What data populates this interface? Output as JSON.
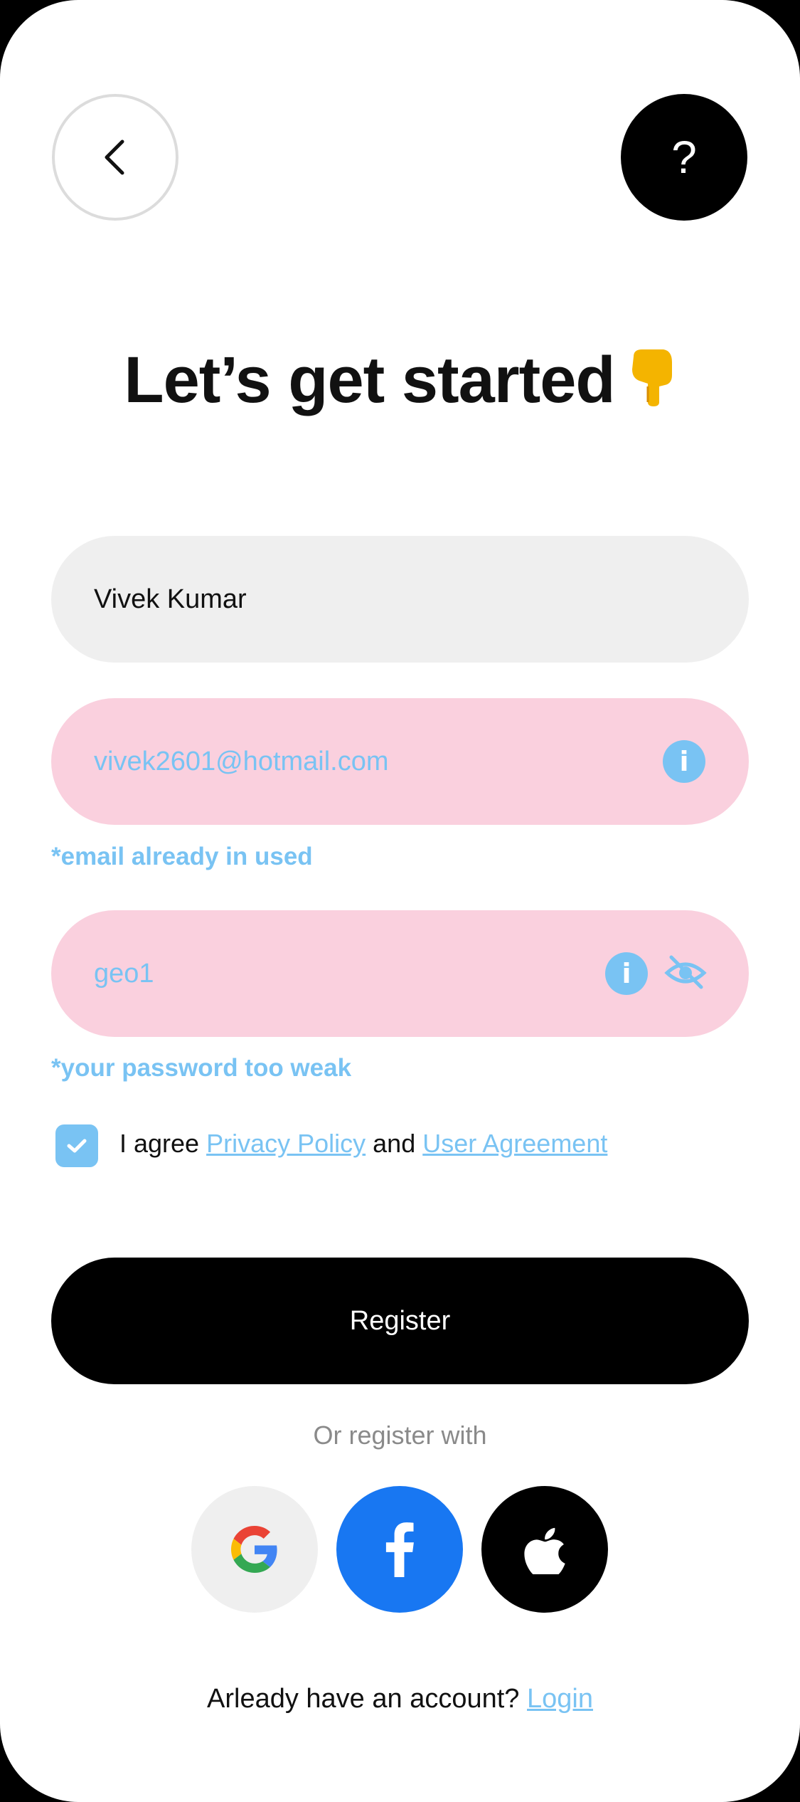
{
  "header": {
    "back_icon": "chevron-left-icon",
    "help_label": "?"
  },
  "title": "Let’s get started",
  "title_emoji": "pointing-down-hand-icon",
  "form": {
    "name_value": "Vivek Kumar",
    "email_value": "vivek2601@hotmail.com",
    "email_error": "*email already in used",
    "password_value": "geo1",
    "password_error": "*your  password too weak",
    "agree_prefix": "I agree ",
    "privacy_link": "Privacy Policy",
    "and_text": " and ",
    "agreement_link": "User Agreement",
    "agree_checked": true,
    "info_glyph": "i"
  },
  "register_label": "Register",
  "or_text": "Or register with",
  "social": [
    "google-icon",
    "facebook-icon",
    "apple-icon"
  ],
  "footer": {
    "prompt": "Arleady have an account? ",
    "login_link": "Login"
  },
  "colors": {
    "accent": "#79c3f3",
    "error_field_bg": "#fad0de",
    "field_bg": "#efefef",
    "primary": "#000000",
    "facebook": "#1877f2"
  }
}
